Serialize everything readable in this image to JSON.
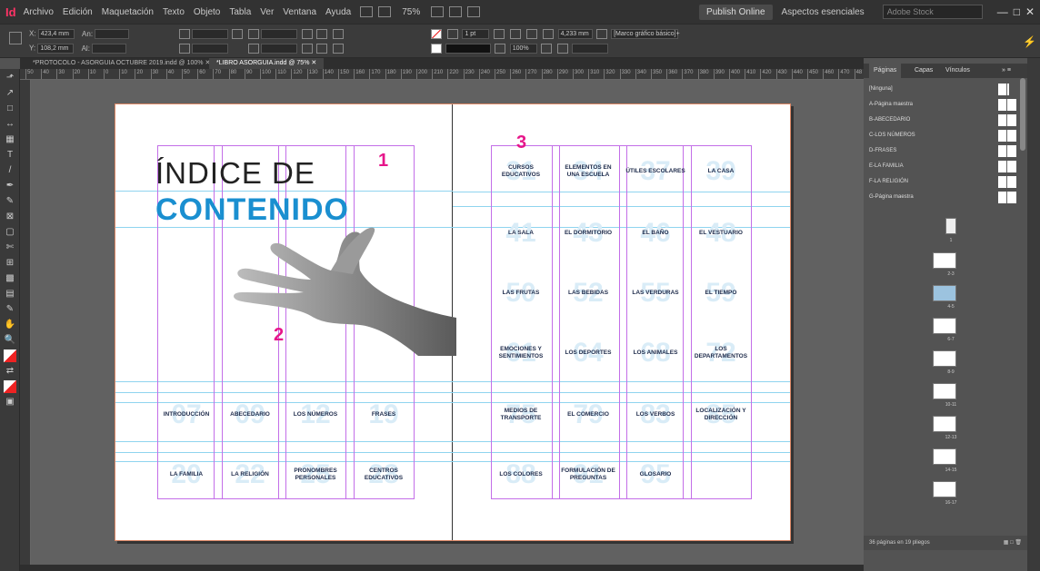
{
  "app": {
    "logo": "Id",
    "menu": [
      "Archivo",
      "Edición",
      "Maquetación",
      "Texto",
      "Objeto",
      "Tabla",
      "Ver",
      "Ventana",
      "Ayuda"
    ],
    "zoom": "75%",
    "publish": "Publish Online",
    "workspace": "Aspectos esenciales",
    "search_placeholder": "Adobe Stock"
  },
  "control": {
    "x_label": "X:",
    "x_value": "423,4 mm",
    "y_label": "Y:",
    "y_value": "108,2 mm",
    "w_label": "An:",
    "h_label": "Al:",
    "stroke_weight": "1 pt",
    "opacity": "100%",
    "dim": "4,233 mm",
    "frame_style": "[Marco gráfico básico]+"
  },
  "tabs": [
    "*PROTOCOLO - ASORGUIA OCTUBRE 2019.indd @ 100%",
    "*LIBRO ASORGUIA.indd @ 75%"
  ],
  "ruler_marks": [
    "50",
    "40",
    "30",
    "20",
    "10",
    "0",
    "10",
    "20",
    "30",
    "40",
    "50",
    "60",
    "70",
    "80",
    "90",
    "100",
    "110",
    "120",
    "130",
    "140",
    "150",
    "160",
    "170",
    "180",
    "190",
    "200",
    "210",
    "220",
    "230",
    "240",
    "250",
    "260",
    "270",
    "280",
    "290",
    "300",
    "310",
    "320",
    "330",
    "340",
    "350",
    "360",
    "370",
    "380",
    "390",
    "400",
    "410",
    "420",
    "430",
    "440",
    "450",
    "460",
    "470",
    "48"
  ],
  "page": {
    "title_line1": "ÍNDICE DE",
    "title_line2": "CONTENIDO",
    "callouts": [
      "1",
      "2",
      "3"
    ],
    "left_cells": [
      {
        "num": "07",
        "label": "INTRODUCCIÓN"
      },
      {
        "num": "09",
        "label": "ABECEDARIO"
      },
      {
        "num": "12",
        "label": "LOS NÚMEROS"
      },
      {
        "num": "19",
        "label": "FRASES"
      },
      {
        "num": "20",
        "label": "LA FAMILIA"
      },
      {
        "num": "22",
        "label": "LA RELIGIÓN"
      },
      {
        "num": "25",
        "label": "PRONOMBRES PERSONALES"
      },
      {
        "num": "28",
        "label": "CENTROS EDUCATIVOS"
      }
    ],
    "right_cells": [
      {
        "num": "31",
        "label": "CURSOS EDUCATIVOS"
      },
      {
        "num": "34",
        "label": "ELEMENTOS EN UNA ESCUELA"
      },
      {
        "num": "37",
        "label": "ÚTILES ESCOLARES"
      },
      {
        "num": "39",
        "label": "LA CASA"
      },
      {
        "num": "41",
        "label": "LA SALA"
      },
      {
        "num": "43",
        "label": "EL DORMITORIO"
      },
      {
        "num": "46",
        "label": "EL BAÑO"
      },
      {
        "num": "48",
        "label": "EL VESTUARIO"
      },
      {
        "num": "50",
        "label": "LAS FRUTAS"
      },
      {
        "num": "52",
        "label": "LAS BEBIDAS"
      },
      {
        "num": "55",
        "label": "LAS VERDURAS"
      },
      {
        "num": "59",
        "label": "EL TIEMPO"
      },
      {
        "num": "61",
        "label": "EMOCIONES Y SENTIMIENTOS"
      },
      {
        "num": "64",
        "label": "LOS DEPORTES"
      },
      {
        "num": "68",
        "label": "LOS ANIMALES"
      },
      {
        "num": "72",
        "label": "LOS DEPARTAMENTOS"
      },
      {
        "num": "75",
        "label": "MEDIOS DE TRANSPORTE"
      },
      {
        "num": "79",
        "label": "EL COMERCIO"
      },
      {
        "num": "83",
        "label": "LOS VERBOS"
      },
      {
        "num": "85",
        "label": "LOCALIZACIÓN Y DIRECCIÓN"
      },
      {
        "num": "88",
        "label": "LOS COLORES"
      },
      {
        "num": "91",
        "label": "FORMULACIÓN DE PREGUNTAS"
      },
      {
        "num": "95",
        "label": "GLOSARIO"
      },
      {
        "num": "",
        "label": ""
      }
    ]
  },
  "panel": {
    "tabs": [
      "Páginas",
      "Capas",
      "Vínculos"
    ],
    "masters": [
      "[Ninguna]",
      "A-Página maestra",
      "B-ABECEDARIO",
      "C-LOS NÚMEROS",
      "D-FRASES",
      "E-LA FAMILIA",
      "F-LA RELIGIÓN",
      "G-Página maestra"
    ],
    "page_labels": [
      "1",
      "2-3",
      "4-5",
      "6-7",
      "8-9",
      "10-11",
      "12-13",
      "14-15",
      "16-17"
    ],
    "footer": "36 páginas en 19 pliegos"
  }
}
